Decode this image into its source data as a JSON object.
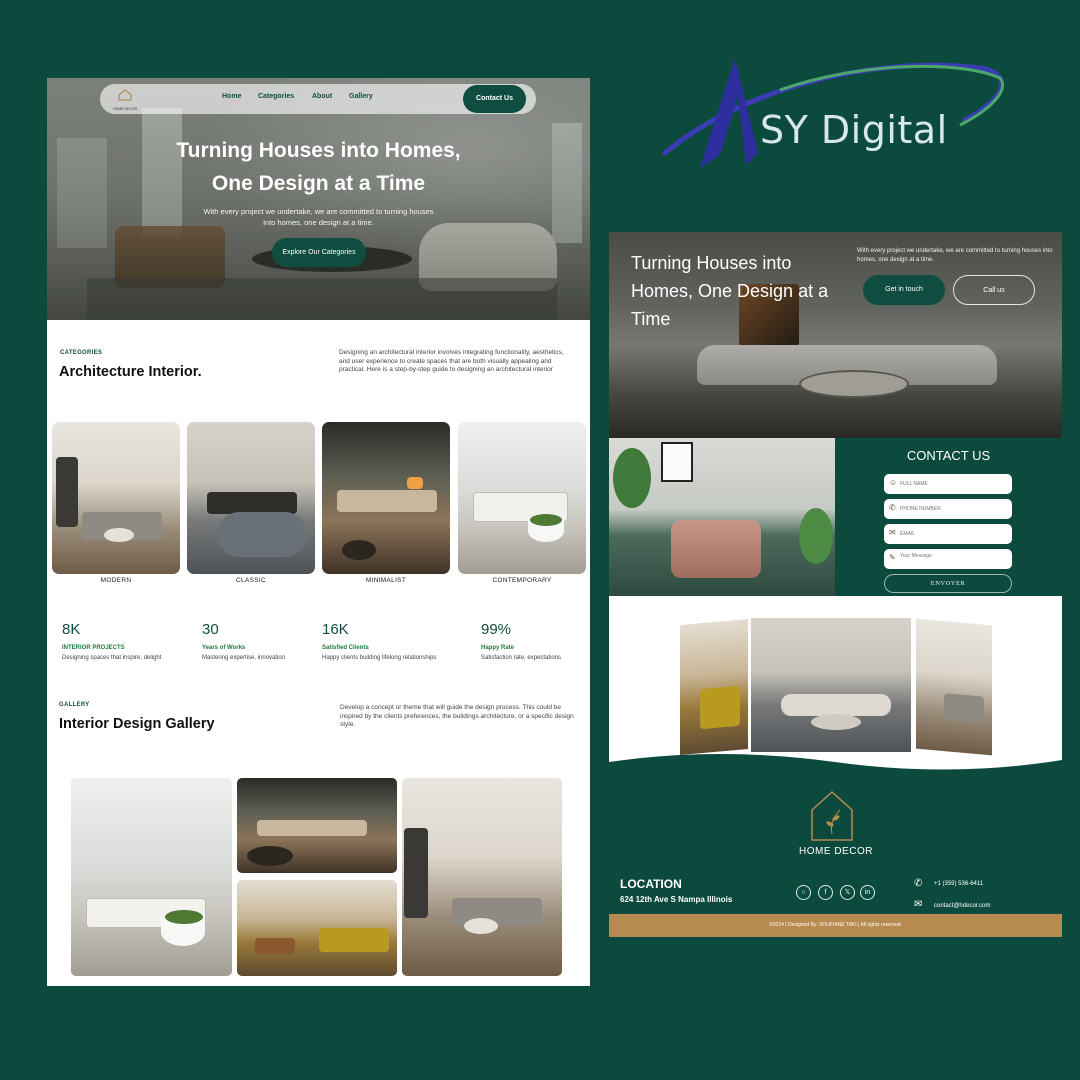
{
  "brand": {
    "name": "SY Digital"
  },
  "left": {
    "nav": {
      "logo_text": "HOME DECOR",
      "links": [
        "Home",
        "Categories",
        "About",
        "Gallery"
      ],
      "cta": "Contact Us"
    },
    "hero": {
      "title_line1": "Turning Houses into Homes,",
      "title_line2": "One Design at a Time",
      "subtitle": "With every project we undertake, we are committed to turning houses into homes, one design at a time.",
      "button": "Explore Our Categories"
    },
    "categories": {
      "eyebrow": "CATEGORIES",
      "title": "Architecture Interior.",
      "description": "Designing an architectural interior involves integrating functionality, aesthetics, and user experience to create spaces that are both visually appealing and practical. Here is a step-by-step guide to designing an architectural interior",
      "items": [
        "MODERN",
        "CLASSIC",
        "MINIMALIST",
        "CONTEMPORARY"
      ]
    },
    "stats": [
      {
        "value": "8K",
        "label": "INTERIOR PROJECTS",
        "desc": "Designing spaces that inspire, delight"
      },
      {
        "value": "30",
        "label": "Years of Works",
        "desc": "Mastering expertise, innovation"
      },
      {
        "value": "16K",
        "label": "Satisfied Clients",
        "desc": "Happy clients building lifelong relationships"
      },
      {
        "value": "99%",
        "label": "Happy Rate",
        "desc": "Satisfaction rate, expectations"
      }
    ],
    "gallery": {
      "eyebrow": "GALLERY",
      "title": "Interior Design Gallery",
      "description": "Develop a concept or theme that will guide the design process. This could be inspired by the clients preferences, the buildings architecture, or a specific design style."
    }
  },
  "right": {
    "hero": {
      "title": "Turning Houses into Homes, One Design at a Time",
      "subtitle": "With every project we undertake, we are committed to turning houses into homes, one design at a time.",
      "primary_button": "Get in touch",
      "secondary_button": "Call us"
    },
    "contact": {
      "title": "CONTACT US",
      "fields": [
        {
          "icon": "user-icon",
          "placeholder": "FULL NAME"
        },
        {
          "icon": "phone-icon",
          "placeholder": "PHONE NUMBER"
        },
        {
          "icon": "mail-icon",
          "placeholder": "EMAIL"
        },
        {
          "icon": "message-icon",
          "placeholder": "Your Message"
        }
      ],
      "submit": "ENVOYER"
    },
    "footer": {
      "brand": "HOME DECOR",
      "location_title": "LOCATION",
      "address": "624 12th Ave S Nampa Illinois",
      "social": [
        "instagram-icon",
        "facebook-icon",
        "x-icon",
        "linkedin-icon"
      ],
      "phone": "+1 (359) 536-6411",
      "email": "contact@hdecor.com",
      "copyright": "©2024 | Designed By: SOUFIANE TAKI | All rights reserved."
    }
  },
  "colors": {
    "primary": "#0f4d40",
    "background": "#0c4a3e",
    "accent": "#b78a50"
  }
}
